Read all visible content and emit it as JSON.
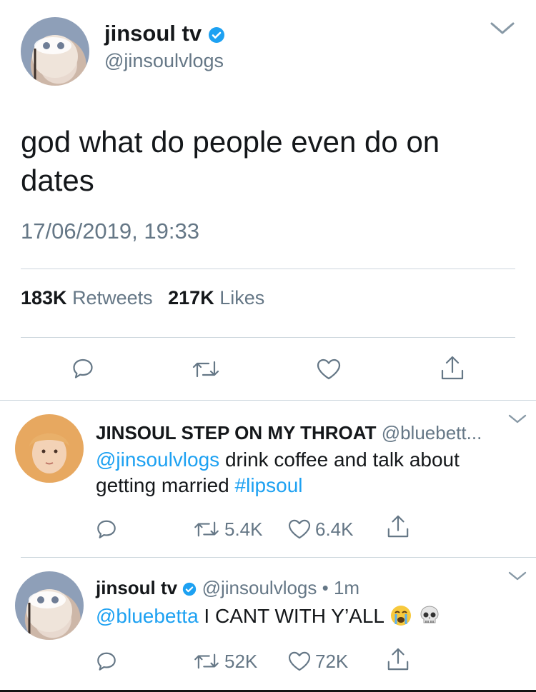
{
  "main_tweet": {
    "display_name": "jinsoul tv",
    "handle": "@jinsoulvlogs",
    "text_line1": "god what do people even do on",
    "text_line2": "dates",
    "timestamp": "17/06/2019, 19:33",
    "retweets_count": "183K",
    "retweets_label": "Retweets",
    "likes_count": "217K",
    "likes_label": "Likes"
  },
  "reply1": {
    "display_name": "JINSOUL STEP ON MY THROAT",
    "handle": "@bluebett...",
    "mention": "@jinsoulvlogs",
    "text1": " drink coffee and talk about",
    "text2": "getting married ",
    "hashtag": "#lipsoul",
    "retweets": "5.4K",
    "likes": "6.4K"
  },
  "reply2": {
    "display_name": "jinsoul tv",
    "handle": "@jinsoulvlogs",
    "time": " • 1m",
    "mention": "@bluebetta",
    "text": " I CANT WITH Y’ALL",
    "retweets": "52K",
    "likes": "72K"
  },
  "colors": {
    "accent": "#1da1f2",
    "muted": "#657786",
    "divider": "#ccd6dd",
    "verified": "#1da1f2"
  },
  "icons": [
    "chevron-down-icon",
    "verified-badge-icon",
    "reply-icon",
    "retweet-icon",
    "heart-icon",
    "share-icon",
    "crying-face-emoji",
    "skull-emoji"
  ]
}
